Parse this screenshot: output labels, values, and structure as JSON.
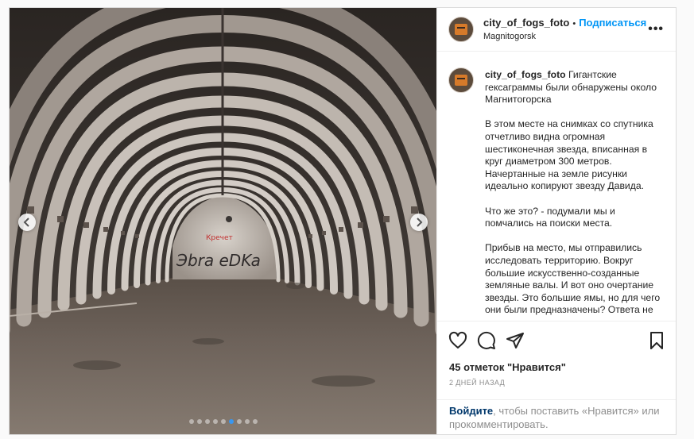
{
  "post": {
    "username": "city_of_fogs_foto",
    "separator": "•",
    "follow_label": "Подписаться",
    "location": "Magnitogorsk",
    "more_label": "•••"
  },
  "caption": {
    "username": "city_of_fogs_foto",
    "title": "Гигантские гексаграммы были обнаружены около Магнитогорска",
    "paragraphs": [
      "В этом месте на снимках со спутника отчетливо видна огромная шестиконечная звезда, вписанная в круг диаметром 300 метров. Начертанные на земле рисунки идеально копируют звезду Давида.",
      "Что же это? - подумали мы и помчались на поиски места.",
      "Прибыв на место, мы отправились исследовать территорию. Вокруг большие искусственно-созданные земляные валы. И вот оно очертание звезды. Это большие ямы, но для чего они были предназначены? Ответа не"
    ]
  },
  "photo": {
    "graffiti_top": "Кречет",
    "graffiti_bottom": "Эbra eDKa",
    "slide_count": 9,
    "active_slide": 5
  },
  "actions": {
    "like_icon": "heart-icon",
    "comment_icon": "comment-icon",
    "share_icon": "paper-plane-icon",
    "save_icon": "bookmark-icon"
  },
  "likes_text": "45 отметок \"Нравится\"",
  "timestamp": "2 ДНЕЙ НАЗАД",
  "footer": {
    "login_label": "Войдите",
    "rest_text": ", чтобы поставить «Нравится» или прокомментировать."
  },
  "colors": {
    "accent": "#0095f6",
    "link": "#00376b",
    "muted": "#8e8e8e"
  }
}
